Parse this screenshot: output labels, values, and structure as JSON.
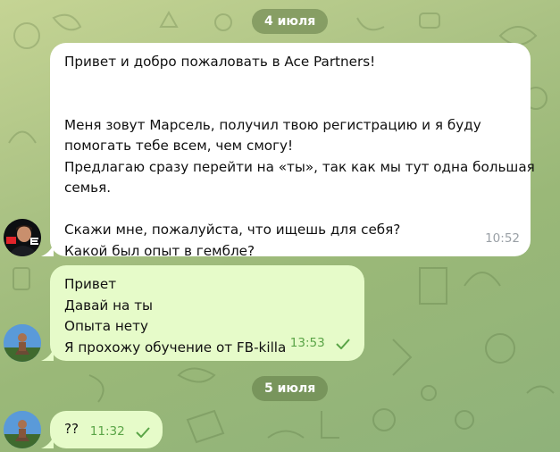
{
  "dates": {
    "first": "4 июля",
    "second": "5 июля"
  },
  "messages": [
    {
      "direction": "incoming",
      "lines": [
        "Привет и добро пожаловать в Ace Partners!",
        "",
        "",
        "Меня зовут Марсель, получил твою регистрацию и я буду",
        "помогать тебе всем, чем смогу!",
        "Предлагаю сразу перейти на «ты», так как мы тут одна большая",
        "семья.",
        "",
        "Скажи мне, пожалуйста, что ищешь для себя?",
        "Какой был опыт в гембле?"
      ],
      "time": "10:52"
    },
    {
      "direction": "outgoing",
      "lines": [
        "Привет",
        "Давай на ты",
        "Опыта нету",
        "Я прохожу обучение от FB-killa"
      ],
      "time": "13:53",
      "status": "sent"
    },
    {
      "direction": "outgoing",
      "lines": [
        "??"
      ],
      "time": "11:32",
      "status": "sent"
    }
  ],
  "colors": {
    "incoming_bubble": "#ffffff",
    "outgoing_bubble": "#e6fbc9",
    "outgoing_meta": "#5aa447",
    "date_pill": "#607a46"
  },
  "icons": {
    "sender_avatar": "ace-partners-avatar",
    "user_avatar": "user-photo-avatar",
    "status": "check-icon"
  }
}
